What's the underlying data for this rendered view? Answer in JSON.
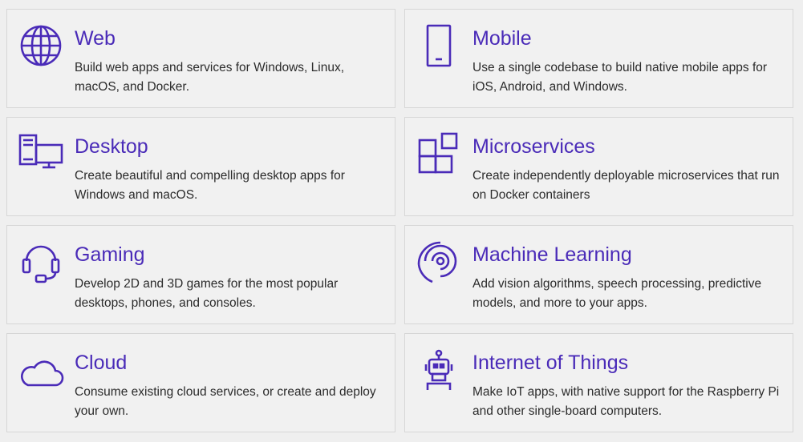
{
  "accent_color": "#4a2bb8",
  "cards": [
    {
      "icon": "globe-icon",
      "title": "Web",
      "description": "Build web apps and services for Windows, Linux, macOS, and Docker."
    },
    {
      "icon": "mobile-phone-icon",
      "title": "Mobile",
      "description": "Use a single codebase to build native mobile apps for iOS, Android, and Windows."
    },
    {
      "icon": "desktop-computer-icon",
      "title": "Desktop",
      "description": "Create beautiful and compelling desktop apps for Windows and macOS."
    },
    {
      "icon": "microservices-blocks-icon",
      "title": "Microservices",
      "description": "Create independently deployable microservices that run on Docker containers"
    },
    {
      "icon": "headset-icon",
      "title": "Gaming",
      "description": "Develop 2D and 3D games for the most popular desktops, phones, and consoles."
    },
    {
      "icon": "signal-waves-icon",
      "title": "Machine Learning",
      "description": "Add vision algorithms, speech processing, predictive models, and more to your apps."
    },
    {
      "icon": "cloud-icon",
      "title": "Cloud",
      "description": "Consume existing cloud services, or create and deploy your own."
    },
    {
      "icon": "robot-icon",
      "title": "Internet of Things",
      "description": "Make IoT apps, with native support for the Raspberry Pi and other single-board computers."
    }
  ]
}
